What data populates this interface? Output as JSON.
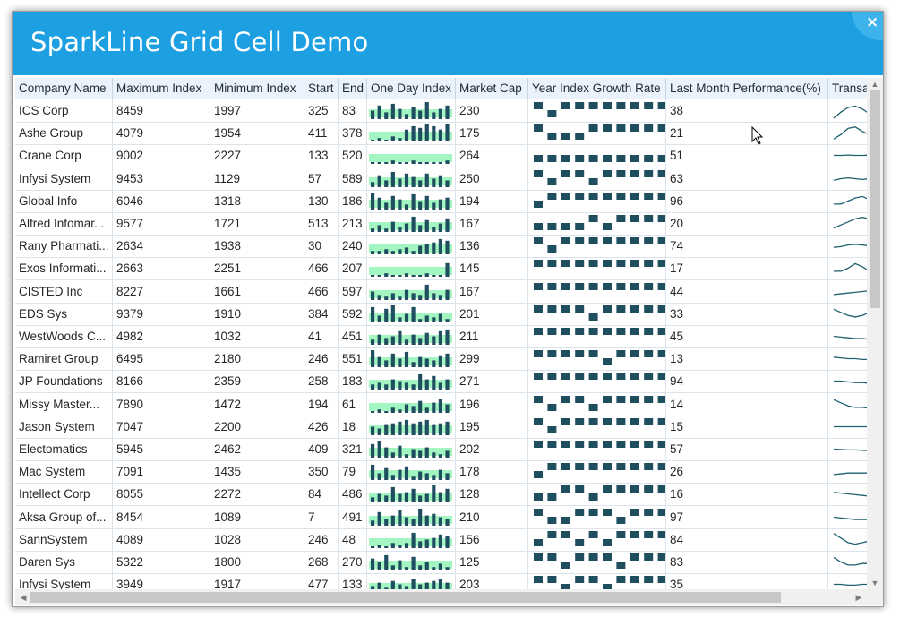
{
  "window": {
    "title": "SparkLine Grid Cell Demo",
    "close_label": "×"
  },
  "colors": {
    "title_bar": "#1ca0e2",
    "header_bg": "#eaf3fb",
    "bar_fill": "#1f4e5f",
    "band_fill": "#a3f5c2",
    "sparkline_stroke": "#1f5f6f"
  },
  "icons": {
    "close": "close-icon",
    "cursor": "mouse-pointer-icon"
  },
  "columns": [
    "Company Name",
    "Maximum Index",
    "Minimum Index",
    "Start",
    "End",
    "One Day Index",
    "Market Cap",
    "Year Index Growth Rate",
    "Last Month Performance(%)",
    "Transa"
  ],
  "rows": [
    {
      "company": "ICS Corp",
      "max": "8459",
      "min": "1997",
      "start": "325",
      "end": "83",
      "market_cap": "230",
      "last_month": "38",
      "one_day": [
        5,
        8,
        4,
        9,
        6,
        3,
        7,
        5,
        10,
        4,
        6,
        8
      ],
      "growth": [
        1,
        -1,
        1,
        1,
        1,
        1,
        1,
        1,
        1,
        1
      ],
      "trans": [
        0,
        0.4,
        0.7,
        0.8,
        0.6,
        0.3,
        0.1
      ]
    },
    {
      "company": "Ashe Group",
      "max": "4079",
      "min": "1954",
      "start": "411",
      "end": "378",
      "market_cap": "175",
      "last_month": "21",
      "one_day": [
        1,
        2,
        1,
        3,
        2,
        7,
        9,
        8,
        10,
        9,
        7,
        10
      ],
      "growth": [
        1,
        -1,
        -1,
        -1,
        1,
        1,
        1,
        1,
        1,
        1
      ],
      "trans": [
        0.1,
        0.4,
        0.8,
        0.9,
        0.6,
        0.4,
        0.2
      ]
    },
    {
      "company": "Crane Corp",
      "max": "9002",
      "min": "2227",
      "start": "133",
      "end": "520",
      "market_cap": "264",
      "last_month": "51",
      "one_day": [
        1,
        1,
        1,
        2,
        1,
        1,
        2,
        1,
        1,
        1,
        1,
        2
      ],
      "growth": [
        -1,
        -1,
        -1,
        -1,
        -1,
        -1,
        -1,
        -1,
        -1,
        -1
      ],
      "trans": [
        0.5,
        0.5,
        0.52,
        0.5,
        0.5,
        0.52,
        0.5
      ]
    },
    {
      "company": "Infysi System",
      "max": "9453",
      "min": "1129",
      "start": "57",
      "end": "589",
      "market_cap": "250",
      "last_month": "63",
      "one_day": [
        3,
        7,
        4,
        9,
        5,
        8,
        6,
        4,
        8,
        5,
        7,
        4
      ],
      "growth": [
        1,
        -1,
        1,
        1,
        -1,
        1,
        1,
        1,
        1,
        1
      ],
      "trans": [
        0.4,
        0.5,
        0.55,
        0.5,
        0.45,
        0.5,
        0.5
      ]
    },
    {
      "company": "Global Info",
      "max": "6046",
      "min": "1318",
      "start": "130",
      "end": "186",
      "market_cap": "194",
      "last_month": "96",
      "one_day": [
        10,
        7,
        4,
        8,
        6,
        3,
        9,
        5,
        8,
        4,
        6,
        7
      ],
      "growth": [
        -1,
        1,
        1,
        1,
        1,
        1,
        1,
        1,
        1,
        1
      ],
      "trans": [
        0.3,
        0.3,
        0.5,
        0.7,
        0.8,
        0.6,
        0.5
      ]
    },
    {
      "company": "Alfred Infomar...",
      "max": "9577",
      "min": "1721",
      "start": "513",
      "end": "213",
      "market_cap": "167",
      "last_month": "20",
      "one_day": [
        2,
        4,
        2,
        6,
        3,
        5,
        9,
        4,
        7,
        3,
        5,
        8
      ],
      "growth": [
        -1,
        -1,
        -1,
        -1,
        1,
        -1,
        1,
        1,
        1,
        1
      ],
      "trans": [
        0.2,
        0.4,
        0.6,
        0.8,
        0.9,
        0.8,
        0.7
      ]
    },
    {
      "company": "Rany Pharmati...",
      "max": "2634",
      "min": "1938",
      "start": "30",
      "end": "240",
      "market_cap": "136",
      "last_month": "74",
      "one_day": [
        2,
        2,
        3,
        2,
        3,
        4,
        2,
        5,
        6,
        7,
        9,
        8
      ],
      "growth": [
        1,
        -1,
        1,
        1,
        1,
        1,
        1,
        1,
        1,
        1
      ],
      "trans": [
        0.4,
        0.45,
        0.55,
        0.6,
        0.55,
        0.5,
        0.5
      ]
    },
    {
      "company": "Exos Informati...",
      "max": "2663",
      "min": "2251",
      "start": "466",
      "end": "207",
      "market_cap": "145",
      "last_month": "17",
      "one_day": [
        1,
        1,
        2,
        1,
        1,
        2,
        1,
        1,
        2,
        1,
        1,
        8
      ],
      "growth": [
        1,
        1,
        1,
        1,
        1,
        1,
        1,
        1,
        1,
        1
      ],
      "trans": [
        0.3,
        0.3,
        0.5,
        0.8,
        0.6,
        0.3,
        0.2
      ]
    },
    {
      "company": "CISTED Inc",
      "max": "8227",
      "min": "1661",
      "start": "466",
      "end": "597",
      "market_cap": "167",
      "last_month": "44",
      "one_day": [
        5,
        3,
        2,
        4,
        2,
        6,
        4,
        3,
        9,
        4,
        3,
        6
      ],
      "growth": [
        1,
        1,
        1,
        1,
        1,
        1,
        1,
        1,
        1,
        1
      ],
      "trans": [
        0.3,
        0.35,
        0.4,
        0.45,
        0.5,
        0.55,
        0.6
      ]
    },
    {
      "company": "EDS Sys",
      "max": "9379",
      "min": "1910",
      "start": "384",
      "end": "592",
      "market_cap": "201",
      "last_month": "33",
      "one_day": [
        9,
        4,
        8,
        10,
        3,
        5,
        9,
        2,
        4,
        3,
        5,
        2
      ],
      "growth": [
        1,
        1,
        1,
        1,
        -1,
        1,
        1,
        1,
        1,
        1
      ],
      "trans": [
        0.8,
        0.6,
        0.4,
        0.3,
        0.4,
        0.6,
        0.7
      ]
    },
    {
      "company": "WestWoods C...",
      "max": "4982",
      "min": "1032",
      "start": "41",
      "end": "451",
      "market_cap": "211",
      "last_month": "45",
      "one_day": [
        3,
        6,
        4,
        5,
        8,
        3,
        6,
        4,
        7,
        5,
        8,
        9
      ],
      "growth": [
        1,
        1,
        1,
        1,
        1,
        1,
        1,
        1,
        1,
        1
      ],
      "trans": [
        0.5,
        0.45,
        0.4,
        0.35,
        0.35,
        0.3,
        0.3
      ]
    },
    {
      "company": "Ramiret Group",
      "max": "6495",
      "min": "2180",
      "start": "246",
      "end": "551",
      "market_cap": "299",
      "last_month": "13",
      "one_day": [
        10,
        6,
        4,
        8,
        5,
        9,
        3,
        6,
        5,
        4,
        7,
        8
      ],
      "growth": [
        1,
        1,
        1,
        1,
        1,
        -1,
        1,
        1,
        1,
        1
      ],
      "trans": [
        0.6,
        0.55,
        0.5,
        0.5,
        0.45,
        0.45,
        0.4
      ]
    },
    {
      "company": "JP Foundations",
      "max": "8166",
      "min": "2359",
      "start": "258",
      "end": "183",
      "market_cap": "271",
      "last_month": "94",
      "one_day": [
        3,
        4,
        3,
        6,
        5,
        4,
        3,
        9,
        6,
        8,
        4,
        6
      ],
      "growth": [
        1,
        1,
        1,
        1,
        1,
        1,
        1,
        1,
        1,
        1
      ],
      "trans": [
        0.5,
        0.5,
        0.45,
        0.4,
        0.4,
        0.35,
        0.3
      ]
    },
    {
      "company": "Missy Master...",
      "max": "7890",
      "min": "1472",
      "start": "194",
      "end": "61",
      "market_cap": "196",
      "last_month": "14",
      "one_day": [
        1,
        2,
        1,
        3,
        2,
        5,
        4,
        7,
        3,
        6,
        8,
        5
      ],
      "growth": [
        1,
        -1,
        1,
        1,
        -1,
        1,
        1,
        1,
        1,
        1
      ],
      "trans": [
        0.8,
        0.6,
        0.4,
        0.3,
        0.3,
        0.25,
        0.2
      ]
    },
    {
      "company": "Jason System",
      "max": "7047",
      "min": "2200",
      "start": "426",
      "end": "18",
      "market_cap": "195",
      "last_month": "15",
      "one_day": [
        5,
        4,
        6,
        7,
        8,
        9,
        7,
        8,
        9,
        6,
        7,
        8
      ],
      "growth": [
        1,
        -1,
        1,
        1,
        1,
        1,
        1,
        1,
        1,
        1
      ],
      "trans": [
        0.5,
        0.5,
        0.5,
        0.5,
        0.5,
        0.5,
        0.5
      ]
    },
    {
      "company": "Electomatics",
      "max": "5945",
      "min": "2462",
      "start": "409",
      "end": "321",
      "market_cap": "202",
      "last_month": "57",
      "one_day": [
        8,
        10,
        6,
        3,
        7,
        2,
        5,
        4,
        6,
        3,
        2,
        4
      ],
      "growth": [
        1,
        1,
        1,
        1,
        1,
        1,
        1,
        1,
        1,
        1
      ],
      "trans": [
        0.5,
        0.48,
        0.45,
        0.45,
        0.42,
        0.4,
        0.4
      ]
    },
    {
      "company": "Mac System",
      "max": "7091",
      "min": "1435",
      "start": "350",
      "end": "79",
      "market_cap": "178",
      "last_month": "26",
      "one_day": [
        9,
        4,
        7,
        3,
        6,
        8,
        2,
        5,
        4,
        3,
        6,
        4
      ],
      "growth": [
        -1,
        1,
        1,
        1,
        1,
        1,
        1,
        1,
        1,
        1
      ],
      "trans": [
        0.3,
        0.35,
        0.4,
        0.4,
        0.4,
        0.4,
        0.4
      ]
    },
    {
      "company": "Intellect Corp",
      "max": "8055",
      "min": "2272",
      "start": "84",
      "end": "486",
      "market_cap": "128",
      "last_month": "16",
      "one_day": [
        3,
        5,
        4,
        9,
        5,
        6,
        8,
        4,
        5,
        10,
        6,
        8
      ],
      "growth": [
        -1,
        -1,
        1,
        1,
        -1,
        1,
        1,
        1,
        1,
        1
      ],
      "trans": [
        0.6,
        0.55,
        0.5,
        0.45,
        0.4,
        0.35,
        0.3
      ]
    },
    {
      "company": "Aksa Group of...",
      "max": "8454",
      "min": "1089",
      "start": "7",
      "end": "491",
      "market_cap": "210",
      "last_month": "97",
      "one_day": [
        3,
        8,
        4,
        6,
        9,
        5,
        4,
        10,
        6,
        7,
        5,
        4
      ],
      "growth": [
        1,
        -1,
        -1,
        1,
        1,
        1,
        -1,
        1,
        1,
        1
      ],
      "trans": [
        0.5,
        0.45,
        0.4,
        0.35,
        0.35,
        0.35,
        0.3
      ]
    },
    {
      "company": "SannSystem",
      "max": "4089",
      "min": "1028",
      "start": "246",
      "end": "48",
      "market_cap": "156",
      "last_month": "84",
      "one_day": [
        1,
        2,
        1,
        3,
        2,
        3,
        9,
        4,
        5,
        6,
        8,
        7
      ],
      "growth": [
        -1,
        1,
        1,
        -1,
        1,
        -1,
        1,
        1,
        1,
        1
      ],
      "trans": [
        0.9,
        0.6,
        0.3,
        0.2,
        0.3,
        0.4,
        0.5
      ]
    },
    {
      "company": "Daren Sys",
      "max": "5322",
      "min": "1800",
      "start": "268",
      "end": "270",
      "market_cap": "125",
      "last_month": "83",
      "one_day": [
        7,
        5,
        9,
        3,
        6,
        2,
        8,
        3,
        5,
        2,
        4,
        2
      ],
      "growth": [
        1,
        1,
        -1,
        1,
        1,
        1,
        -1,
        1,
        1,
        1
      ],
      "trans": [
        0.8,
        0.5,
        0.3,
        0.3,
        0.4,
        0.4,
        0.4
      ]
    },
    {
      "company": "Infysi System",
      "max": "3949",
      "min": "1917",
      "start": "477",
      "end": "133",
      "market_cap": "203",
      "last_month": "35",
      "one_day": [
        4,
        6,
        3,
        7,
        5,
        4,
        8,
        5,
        6,
        7,
        8,
        6
      ],
      "growth": [
        1,
        1,
        -1,
        1,
        1,
        -1,
        1,
        1,
        1,
        1
      ],
      "trans": [
        0.5,
        0.5,
        0.45,
        0.45,
        0.5,
        0.5,
        0.5
      ]
    }
  ]
}
